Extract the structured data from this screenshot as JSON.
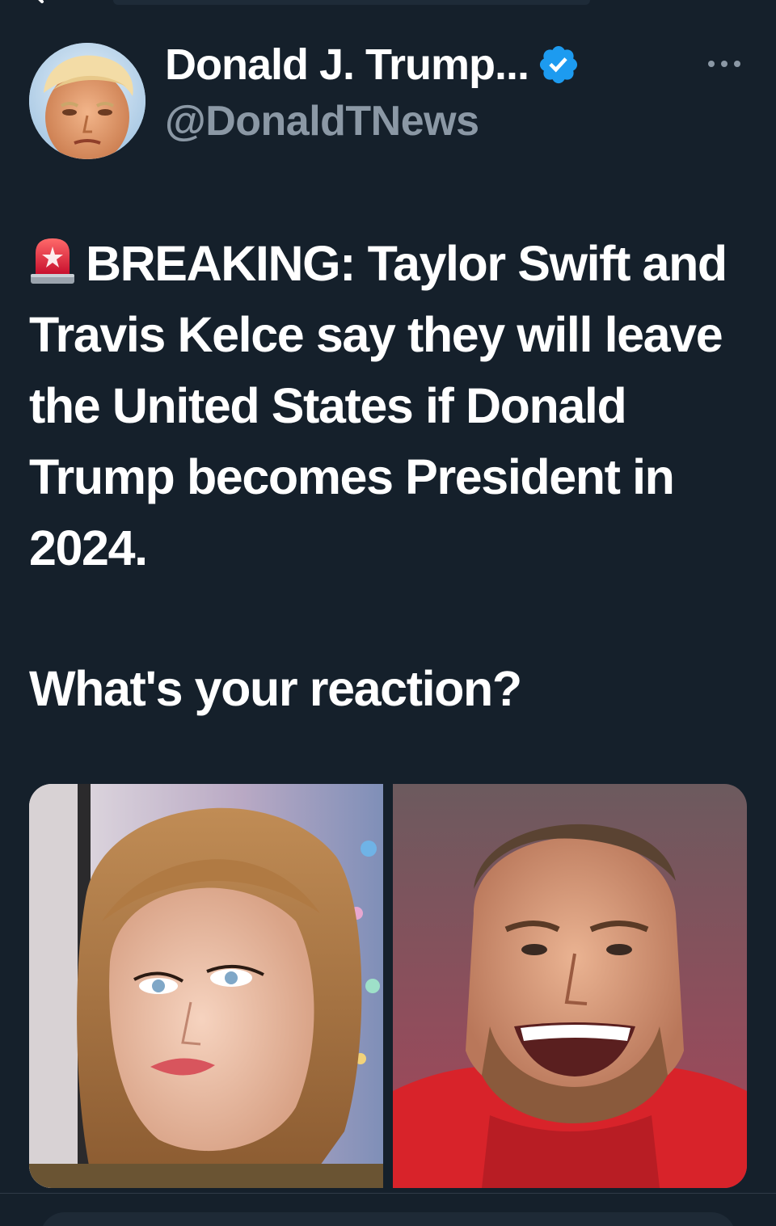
{
  "tweet": {
    "author": {
      "display_name": "Donald J. Trump...",
      "handle": "@DonaldTNews",
      "verified": true,
      "verified_color": "#1d9bf0"
    },
    "text_lines": [
      "BREAKING: Taylor Swift and Travis Kelce say they will leave the United States if Donald Trump becomes President in 2024.",
      "What's your reaction?"
    ],
    "leading_emoji": "police-car-light",
    "media": [
      {
        "name": "taylor-swift-photo"
      },
      {
        "name": "travis-kelce-photo"
      }
    ]
  },
  "icons": {
    "more": "more-options-icon",
    "verified": "verified-badge-icon",
    "siren": "siren-icon"
  },
  "colors": {
    "background": "#15202b",
    "text_primary": "#ffffff",
    "text_secondary": "#8b98a5",
    "accent": "#1d9bf0"
  }
}
